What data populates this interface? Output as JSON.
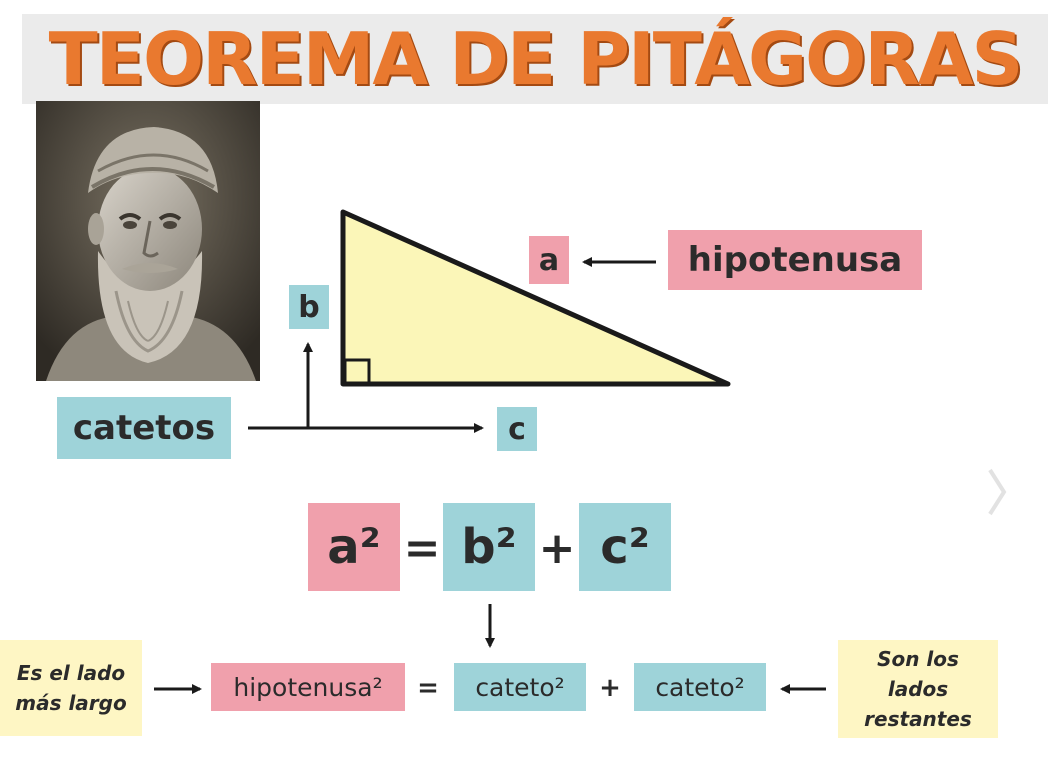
{
  "title": "TEOREMA DE PITÁGORAS",
  "diagram": {
    "label_a": "a",
    "label_b": "b",
    "label_c": "c",
    "hypotenuse_label": "hipotenusa",
    "legs_label": "catetos"
  },
  "formula": {
    "a_sq": "a²",
    "equals": "=",
    "b_sq": "b²",
    "plus": "+",
    "c_sq": "c²"
  },
  "word_formula": {
    "hyp_sq": "hipotenusa²",
    "equals": "=",
    "leg1_sq": "cateto²",
    "plus": "+",
    "leg2_sq": "cateto²"
  },
  "notes": {
    "left": "Es el lado más largo",
    "right": "Son los lados restantes"
  },
  "colors": {
    "pink": "#f0a0ac",
    "teal": "#9ed3d9",
    "cream": "#fef6c4",
    "triangle_fill": "#fbf6b8",
    "title_orange": "#e9792f"
  }
}
